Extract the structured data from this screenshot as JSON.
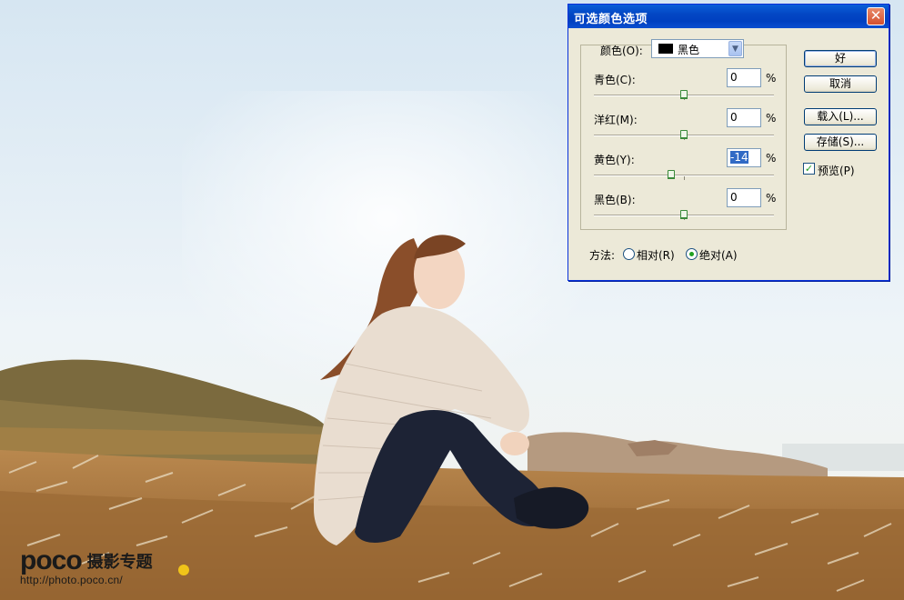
{
  "dialog": {
    "title": "可选颜色选项",
    "colors_label": "颜色(O):",
    "colors_value": "黑色",
    "swatch_color": "#000000",
    "rows": [
      {
        "label": "青色(C):",
        "value": "0",
        "unit": "%",
        "slider_fraction": 0.5
      },
      {
        "label": "洋红(M):",
        "value": "0",
        "unit": "%",
        "slider_fraction": 0.5
      },
      {
        "label": "黄色(Y):",
        "value": "-14",
        "unit": "%",
        "slider_fraction": 0.43
      },
      {
        "label": "黑色(B):",
        "value": "0",
        "unit": "%",
        "slider_fraction": 0.5
      }
    ],
    "buttons": {
      "ok": "好",
      "cancel": "取消",
      "load": "载入(L)...",
      "save": "存储(S)..."
    },
    "preview": {
      "label": "预览(P)",
      "checked": true
    },
    "method": {
      "label": "方法:",
      "relative": "相对(R)",
      "absolute": "绝对(A)",
      "selected": "absolute"
    },
    "close_glyph": "✕"
  },
  "watermark": {
    "logo": "poco",
    "title": "摄影专题",
    "url": "http://photo.poco.cn/"
  }
}
